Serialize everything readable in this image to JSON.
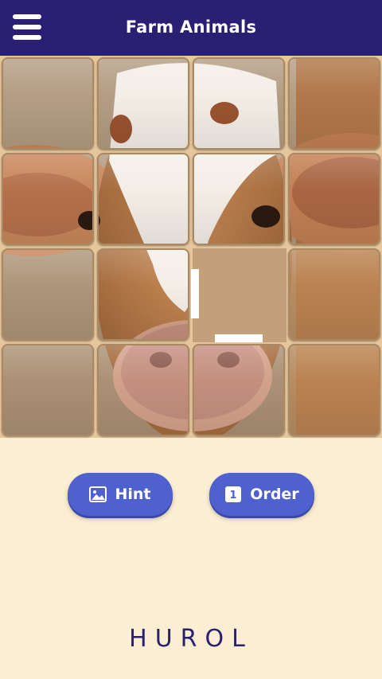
{
  "header": {
    "title": "Farm Animals",
    "menu_icon": "hamburger-menu-icon"
  },
  "puzzle": {
    "grid": "4x4",
    "image_subject": "calf",
    "empty_cell": {
      "row": 3,
      "col": 3
    }
  },
  "buttons": {
    "hint_label": "Hint",
    "hint_icon": "image-icon",
    "order_label": "Order",
    "order_icon": "number-1-icon",
    "order_badge": "1"
  },
  "footer": {
    "brand": "HUROL"
  },
  "colors": {
    "header": "#2a1f73",
    "background": "#fbefd3",
    "button": "#4f60cf"
  }
}
